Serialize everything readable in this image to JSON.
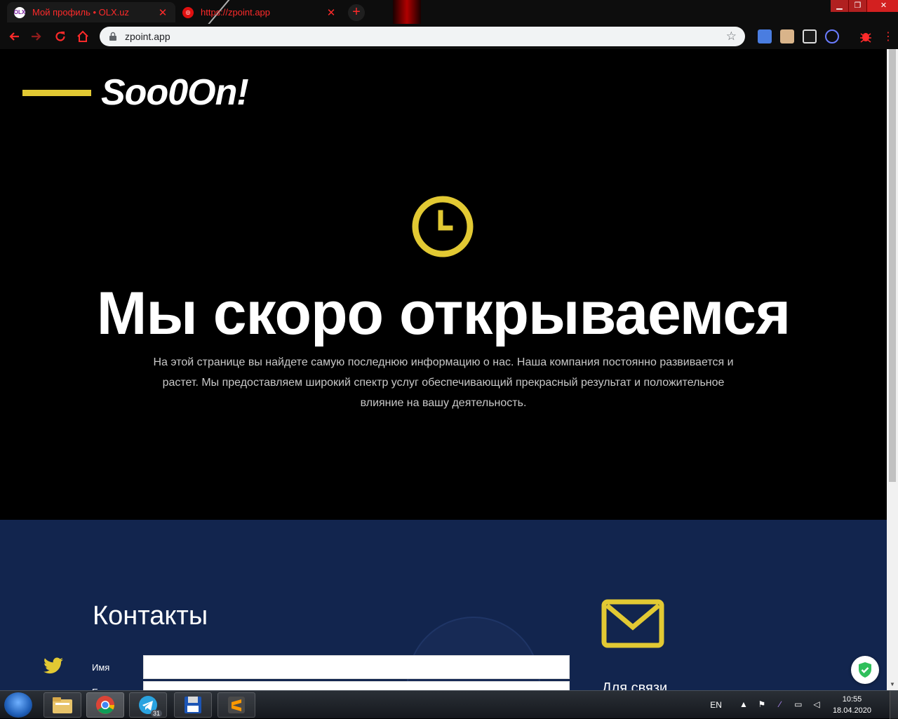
{
  "browser": {
    "tabs": [
      {
        "title": "Мой профиль • OLX.uz",
        "favicon": "olx-icon"
      },
      {
        "title": "https://zpoint.app",
        "favicon": "globe-icon"
      }
    ],
    "new_tab": "+",
    "window_controls": {
      "minimize": "▁",
      "maximize": "❐",
      "close": "✕"
    },
    "url": "zpoint.app",
    "accent": "#ff2a2a"
  },
  "page": {
    "logo": "Soo0On!",
    "hero": {
      "title": "Мы скоро открываемся",
      "description": "На этой странице вы найдете самую последнюю информацию о нас. Наша компания постоянно развивается и растет. Мы предоставляем широкий спектр услуг обеспечивающий прекрасный результат и положительное влияние на вашу деятельность."
    },
    "contacts": {
      "heading": "Контакты",
      "name_label": "Имя",
      "second_label": "Е",
      "contact_heading": "Для связи"
    },
    "colors": {
      "accent_yellow": "#e2c933",
      "contacts_bg": "#12254e"
    }
  },
  "taskbar": {
    "apps": [
      "explorer-icon",
      "chrome-icon",
      "telegram-icon",
      "save-icon",
      "sublime-icon"
    ],
    "telegram_badge": "31",
    "language": "EN",
    "time": "10:55",
    "date": "18.04.2020"
  }
}
